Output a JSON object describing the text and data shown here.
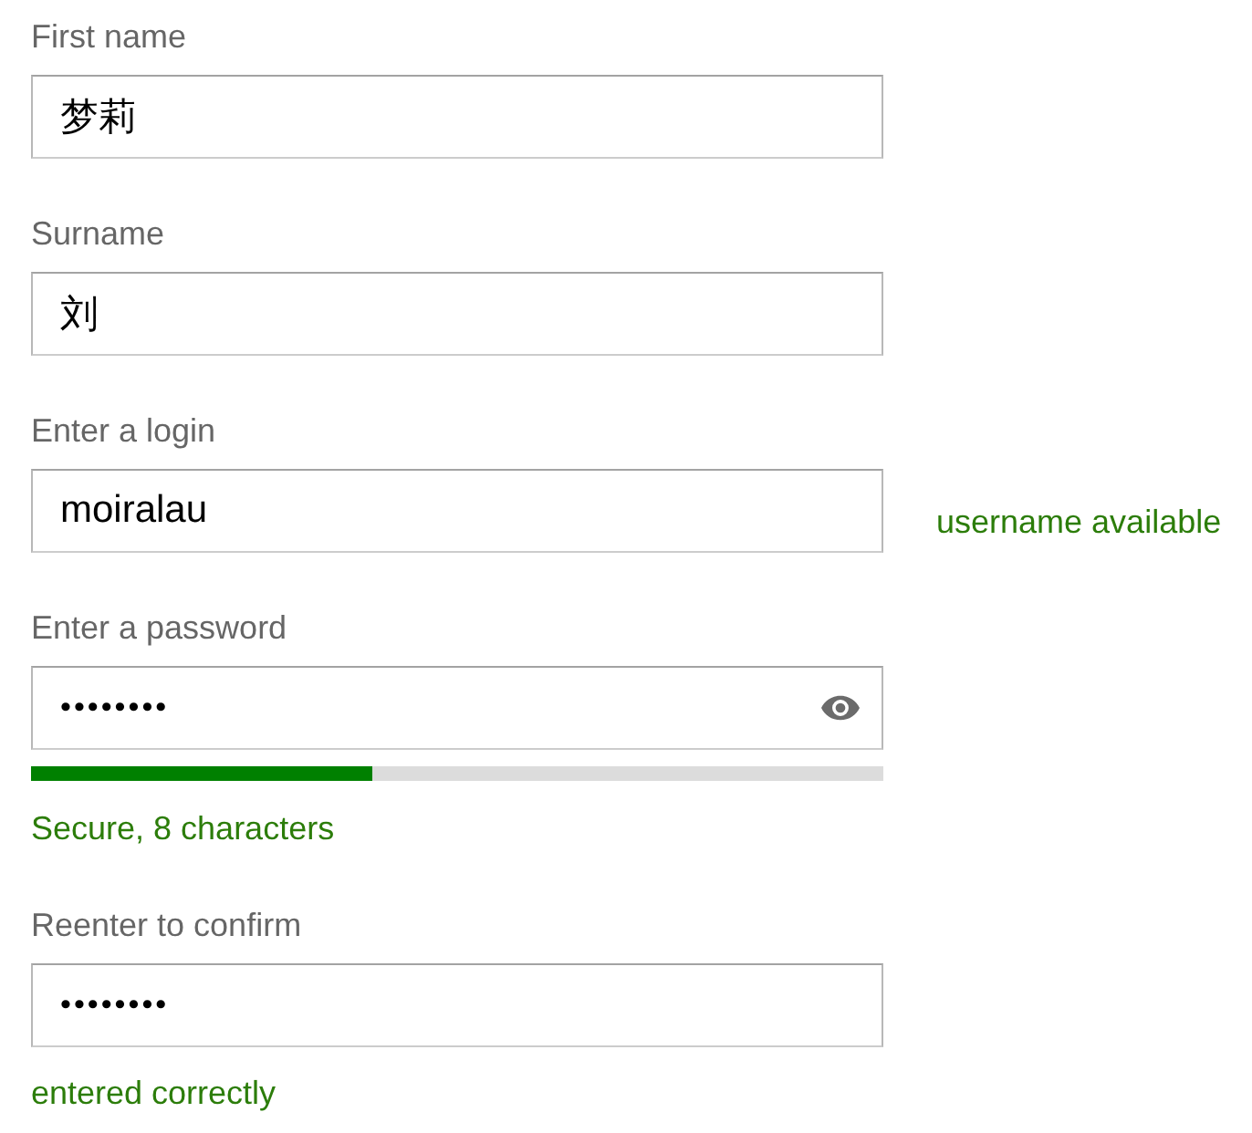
{
  "fields": [
    {
      "kind": "text",
      "label": "First name",
      "value": "梦莉"
    },
    {
      "kind": "text",
      "label": "Surname",
      "value": "刘"
    },
    {
      "kind": "text",
      "label": "Enter a login",
      "value": "moiralau",
      "side_note": "username available"
    },
    {
      "kind": "password",
      "label": "Enter a password",
      "value": "••••••••",
      "reveal_toggle": true,
      "strength": {
        "level": 0.4
      },
      "status_note": "Secure, 8 characters"
    },
    {
      "kind": "password",
      "label": "Reenter to confirm",
      "value": "••••••••",
      "reveal_toggle": false,
      "status_note": "entered correctly"
    }
  ]
}
